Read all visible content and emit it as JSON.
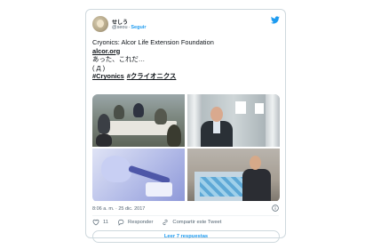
{
  "author": {
    "name": "せしう",
    "handle": "@seou",
    "separator": "·",
    "follow_label": "Seguir"
  },
  "tweet": {
    "lines": [
      "Cryonics: Alcor Life Extension Foundation",
      "alcor.org",
      "あった、これだ…",
      "( Д )"
    ],
    "hashtags": [
      "#Cryonics",
      "#クライオニクス"
    ]
  },
  "timestamp": "8:06 a. m. · 25 dic. 2017",
  "actions": {
    "likes_count": "11",
    "reply_label": "Responder",
    "share_label": "Compartir este Tweet"
  },
  "replies_button": "Leer 7 respuestas",
  "colors": {
    "accent": "#1d9bf0",
    "text": "#0f1419",
    "muted": "#536471",
    "border": "#cfd9de"
  },
  "icons": [
    "twitter-bird-icon",
    "info-icon",
    "heart-icon",
    "reply-icon",
    "share-icon"
  ]
}
